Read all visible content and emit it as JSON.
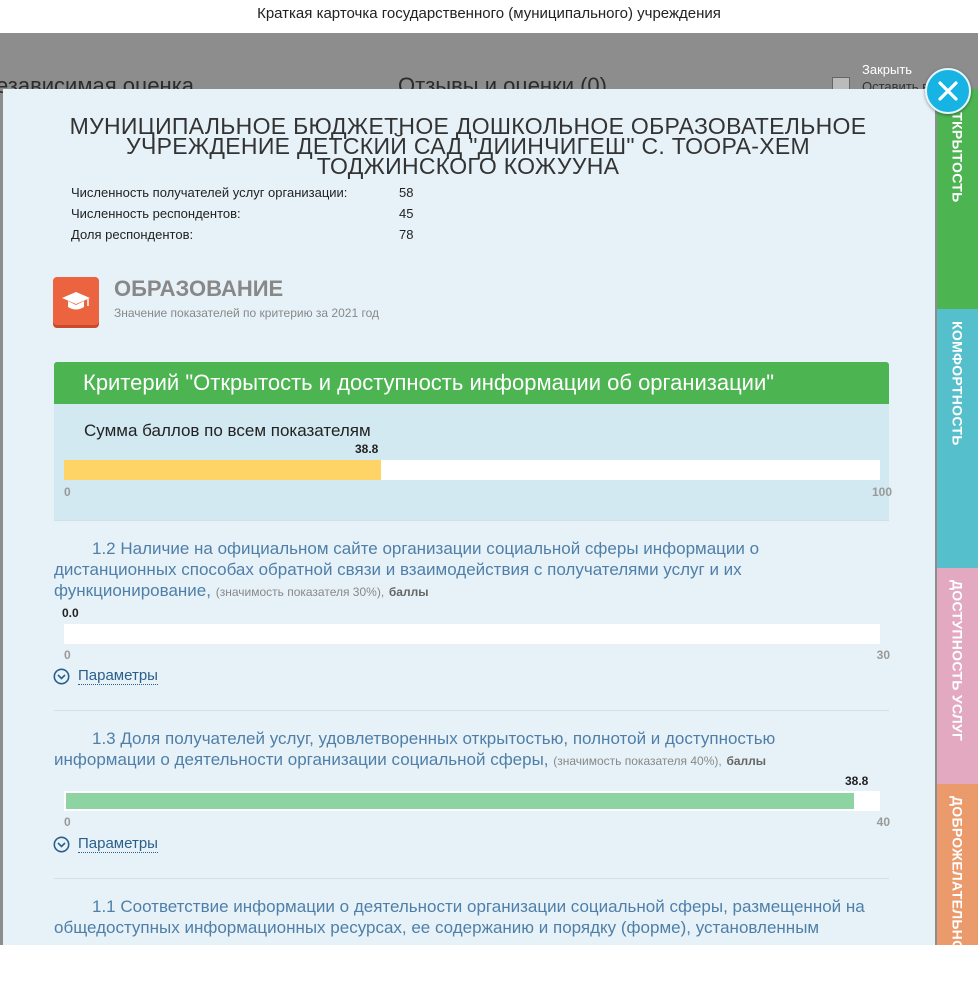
{
  "window": {
    "title": "Краткая карточка государственного (муниципального) учреждения"
  },
  "background": {
    "left_heading": "езависимая оценка",
    "right_heading": "Отзывы и оценки (0)",
    "right_small": "Оставить в"
  },
  "close": {
    "label": "Закрыть",
    "icon": "close-icon"
  },
  "organization": {
    "name": "МУНИЦИПАЛЬНОЕ БЮДЖЕТНОЕ ДОШКОЛЬНОЕ ОБРАЗОВАТЕЛЬНОЕ УЧРЕЖДЕНИЕ ДЕТСКИЙ САД \"ДИИНЧИГЕШ\" С. ТООРА-ХЕМ ТОДЖИНСКОГО КОЖУУНА",
    "stats": [
      {
        "label": "Численность получателей услуг организации:",
        "value": "58"
      },
      {
        "label": "Численность респондентов:",
        "value": "45"
      },
      {
        "label": "Доля респондентов:",
        "value": "78"
      }
    ]
  },
  "section": {
    "icon": "graduation-cap-icon",
    "title": "ОБРАЗОВАНИЕ",
    "subtitle": "Значение показателей по критерию за 2021 год"
  },
  "criterion": {
    "title": "Критерий \"Открытость и доступность информации об организации\"",
    "sum_label": "Сумма баллов по всем показателям",
    "sum_value": "38.8",
    "sum_fraction": 0.388,
    "axis_min": "0",
    "axis_max": "100",
    "colors": {
      "header": "#4db452",
      "sum_bar": "#fed466",
      "indicator_bar": "#8ed4a3"
    }
  },
  "indicators": [
    {
      "text": "1.2 Наличие на официальном сайте организации социальной сферы информации о дистанционных способах обратной связи и взаимодействия с получателями услуг и их функционирование,",
      "weight": "(значимость показателя 30%),",
      "unit": "баллы",
      "value": "0.0",
      "fraction": 0.0,
      "axis_min": "0",
      "axis_max": "30",
      "params_label": "Параметры"
    },
    {
      "text": "1.3 Доля получателей услуг, удовлетворенных открытостью, полнотой и доступностью информации о деятельности организации социальной сферы,",
      "weight": "(значимость показателя 40%),",
      "unit": "баллы",
      "value": "38.8",
      "fraction": 0.97,
      "axis_min": "0",
      "axis_max": "40",
      "params_label": "Параметры"
    },
    {
      "text": "1.1 Соответствие информации о деятельности организации социальной сферы, размещенной на общедоступных информационных ресурсах, ее содержанию и порядку (форме), установленным"
    }
  ],
  "tabs": [
    {
      "label": "ОТКРЫТОСТЬ",
      "color": "#4db452"
    },
    {
      "label": "КОМФОРТНОСТЬ",
      "color": "#55c0cc"
    },
    {
      "label": "ДОСТУПНОСТЬ УСЛУГ",
      "color": "#e2a9c0"
    },
    {
      "label": "ДОБРОЖЕЛАТЕЛЬНОСТЬ",
      "color": "#eb9a6c"
    }
  ]
}
